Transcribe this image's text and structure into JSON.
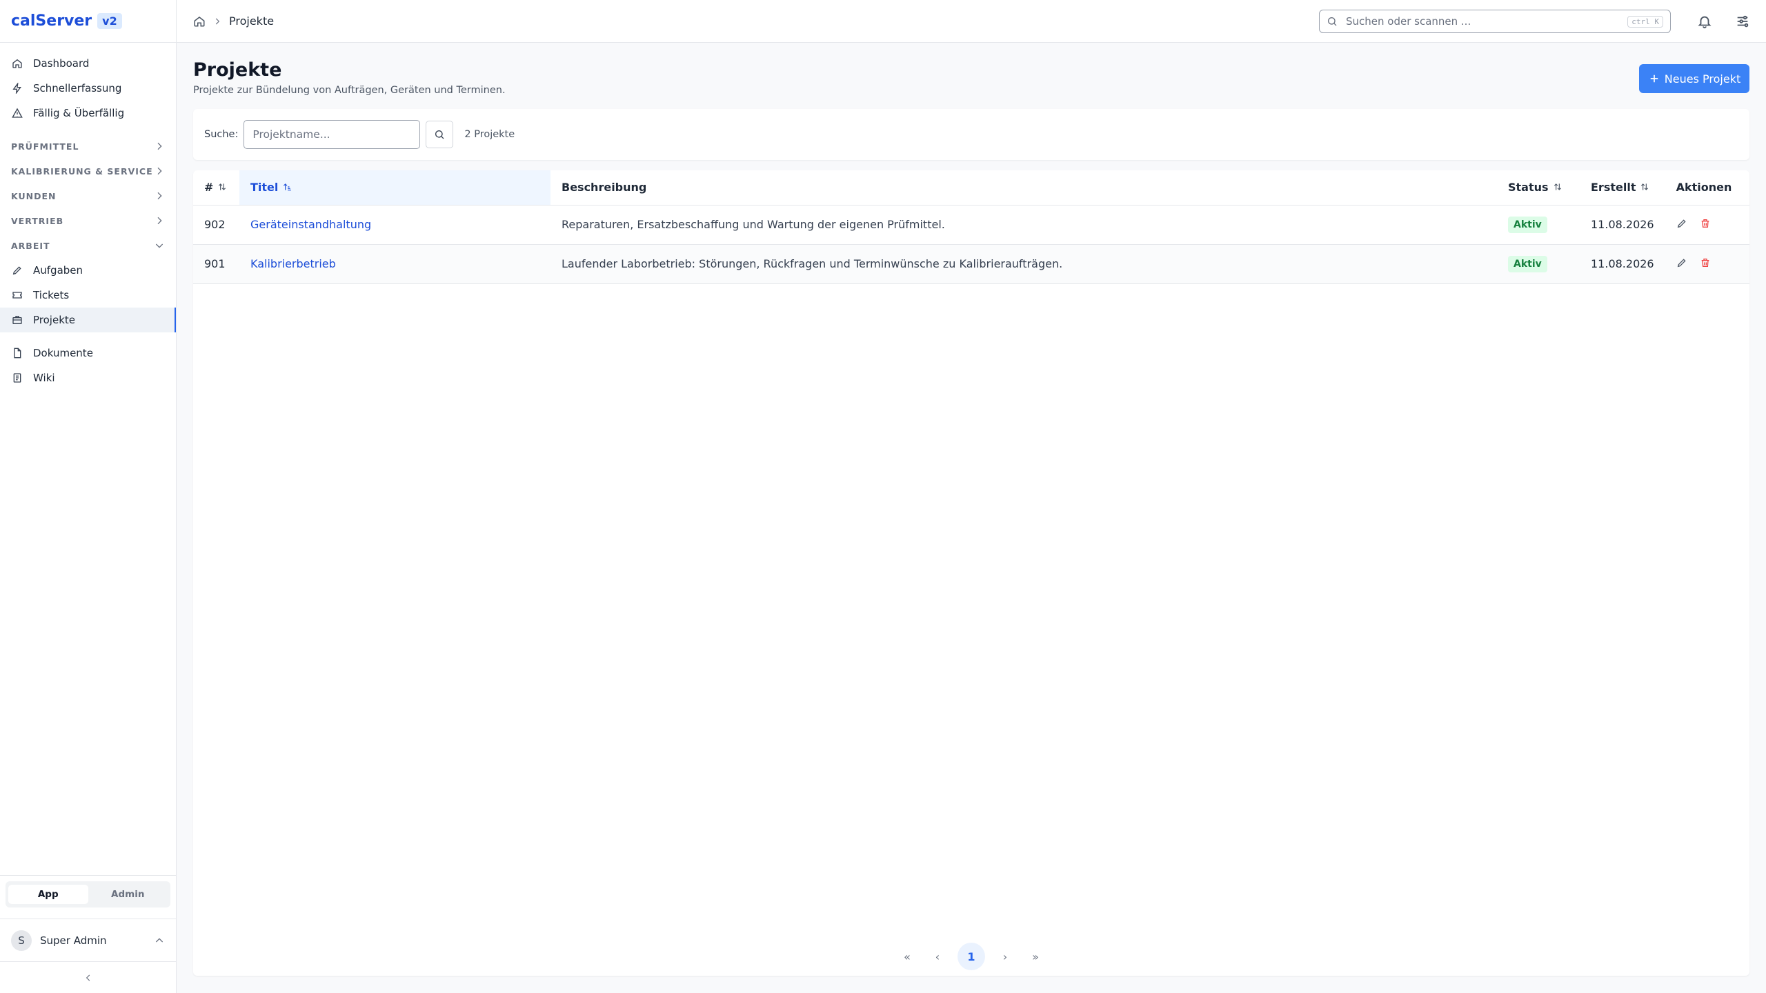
{
  "app": {
    "name": "calServer",
    "version": "v2"
  },
  "sidebar": {
    "top_items": [
      {
        "label": "Dashboard",
        "icon": "home-icon"
      },
      {
        "label": "Schnellerfassung",
        "icon": "bolt-icon"
      },
      {
        "label": "Fällig & Überfällig",
        "icon": "warning-icon"
      }
    ],
    "sections": [
      {
        "label": "PRÜFMITTEL",
        "expanded": false
      },
      {
        "label": "KALIBRIERUNG & SERVICE",
        "expanded": false
      },
      {
        "label": "KUNDEN",
        "expanded": false
      },
      {
        "label": "VERTRIEB",
        "expanded": false
      },
      {
        "label": "ARBEIT",
        "expanded": true
      }
    ],
    "work_items": [
      {
        "label": "Aufgaben",
        "icon": "pencil-icon"
      },
      {
        "label": "Tickets",
        "icon": "ticket-icon"
      },
      {
        "label": "Projekte",
        "icon": "briefcase-icon",
        "active": true
      }
    ],
    "bottom_items": [
      {
        "label": "Dokumente",
        "icon": "document-icon"
      },
      {
        "label": "Wiki",
        "icon": "book-icon"
      }
    ],
    "mode_switch": {
      "app": "App",
      "admin": "Admin",
      "selected": "App"
    },
    "user": {
      "initial": "S",
      "name": "Super Admin"
    }
  },
  "topbar": {
    "breadcrumb": "Projekte",
    "search_placeholder": "Suchen oder scannen ...",
    "shortcut": "ctrl K"
  },
  "page": {
    "title": "Projekte",
    "subtitle": "Projekte zur Bündelung von Aufträgen, Geräten und Terminen.",
    "new_button": "Neues Projekt"
  },
  "filter": {
    "label": "Suche:",
    "placeholder": "Projektname...",
    "count": "2 Projekte"
  },
  "table": {
    "columns": {
      "id": "#",
      "title": "Titel",
      "description": "Beschreibung",
      "status": "Status",
      "created": "Erstellt",
      "actions": "Aktionen"
    },
    "sorted_column": "Titel",
    "rows": [
      {
        "id": "902",
        "title": "Geräteinstandhaltung",
        "description": "Reparaturen, Ersatzbeschaffung und Wartung der eigenen Prüfmittel.",
        "status": "Aktiv",
        "created": "11.08.2026"
      },
      {
        "id": "901",
        "title": "Kalibrierbetrieb",
        "description": "Laufender Laborbetrieb: Störungen, Rückfragen und Terminwünsche zu Kalibrieraufträgen.",
        "status": "Aktiv",
        "created": "11.08.2026"
      }
    ]
  },
  "pagination": {
    "current": "1",
    "first": "«",
    "prev": "‹",
    "next": "›",
    "last": "»"
  },
  "colors": {
    "accent": "#3b82f6",
    "link": "#1d4ed8",
    "status_active_bg": "#dcfce7",
    "status_active_text": "#15803d",
    "danger": "#ef4444"
  }
}
